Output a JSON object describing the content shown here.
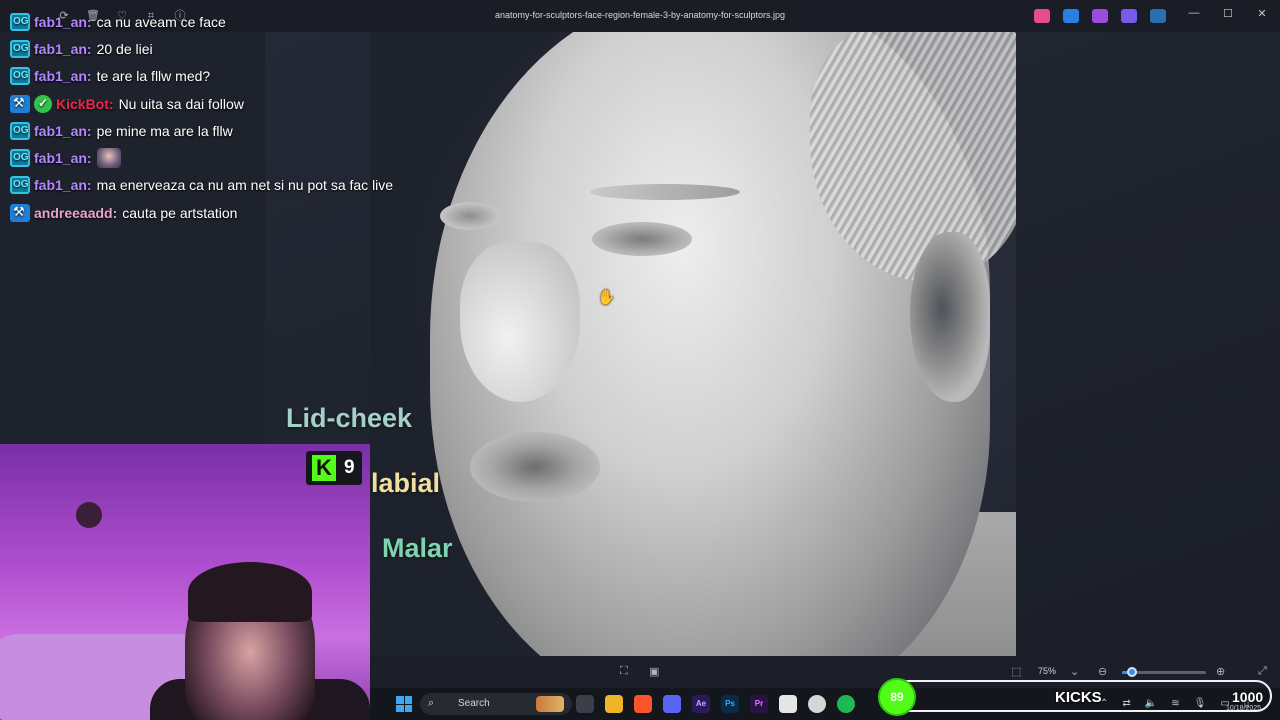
{
  "window": {
    "title": "anatomy-for-sculptors-face-region-female-3-by-anatomy-for-sculptors.jpg",
    "controls": {
      "minimize": "—",
      "maximize": "☐",
      "close": "✕"
    }
  },
  "toolbar_icons": [
    "rotate-icon",
    "delete-icon",
    "favorite-icon",
    "crop-icon",
    "info-icon",
    "more-icon"
  ],
  "chat": {
    "messages": [
      {
        "badges": [
          "og"
        ],
        "user": "fab1_an:",
        "text": "ca nu aveam ce face"
      },
      {
        "badges": [
          "og"
        ],
        "user": "fab1_an:",
        "text": "20 de liei"
      },
      {
        "badges": [
          "og"
        ],
        "user": "fab1_an:",
        "text": "te are la fllw med?"
      },
      {
        "badges": [
          "moderator",
          "verified"
        ],
        "user": "KickBot:",
        "text": "Nu uita sa dai follow"
      },
      {
        "badges": [
          "og"
        ],
        "user": "fab1_an:",
        "text": "pe mine ma are la fllw"
      },
      {
        "badges": [
          "og"
        ],
        "user": "fab1_an:",
        "text": ""
      },
      {
        "badges": [
          "og"
        ],
        "user": "fab1_an:",
        "text": "ma enerveaza ca nu am net si nu pot sa fac live"
      },
      {
        "badges": [
          "moderator"
        ],
        "user": "andreeaadd:",
        "text": "cauta pe artstation"
      }
    ]
  },
  "labels": {
    "lid_cheek": "Lid-cheek",
    "labial": "labial",
    "malar": "Malar"
  },
  "webcam": {
    "kick_badge_count": "9"
  },
  "statusbar": {
    "zoom": "75%",
    "zoom_fraction": 0.12
  },
  "taskbar": {
    "search_placeholder": "Search"
  },
  "kicks_goal": {
    "count": "89",
    "label": "KICKS",
    "goal": "1000",
    "date": "10/18/2025"
  },
  "colors": {
    "kick_green": "#53fc18",
    "og_badge": "#35c2e3",
    "fab1_an_name": "#b387ff",
    "kickbot_name": "#e8284f",
    "andreeaadd_name": "#e8a4c9",
    "lid_cheek_label": "#a5d0c8",
    "labial_label": "#f1dfa0",
    "malar_label": "#7ed4ad"
  }
}
